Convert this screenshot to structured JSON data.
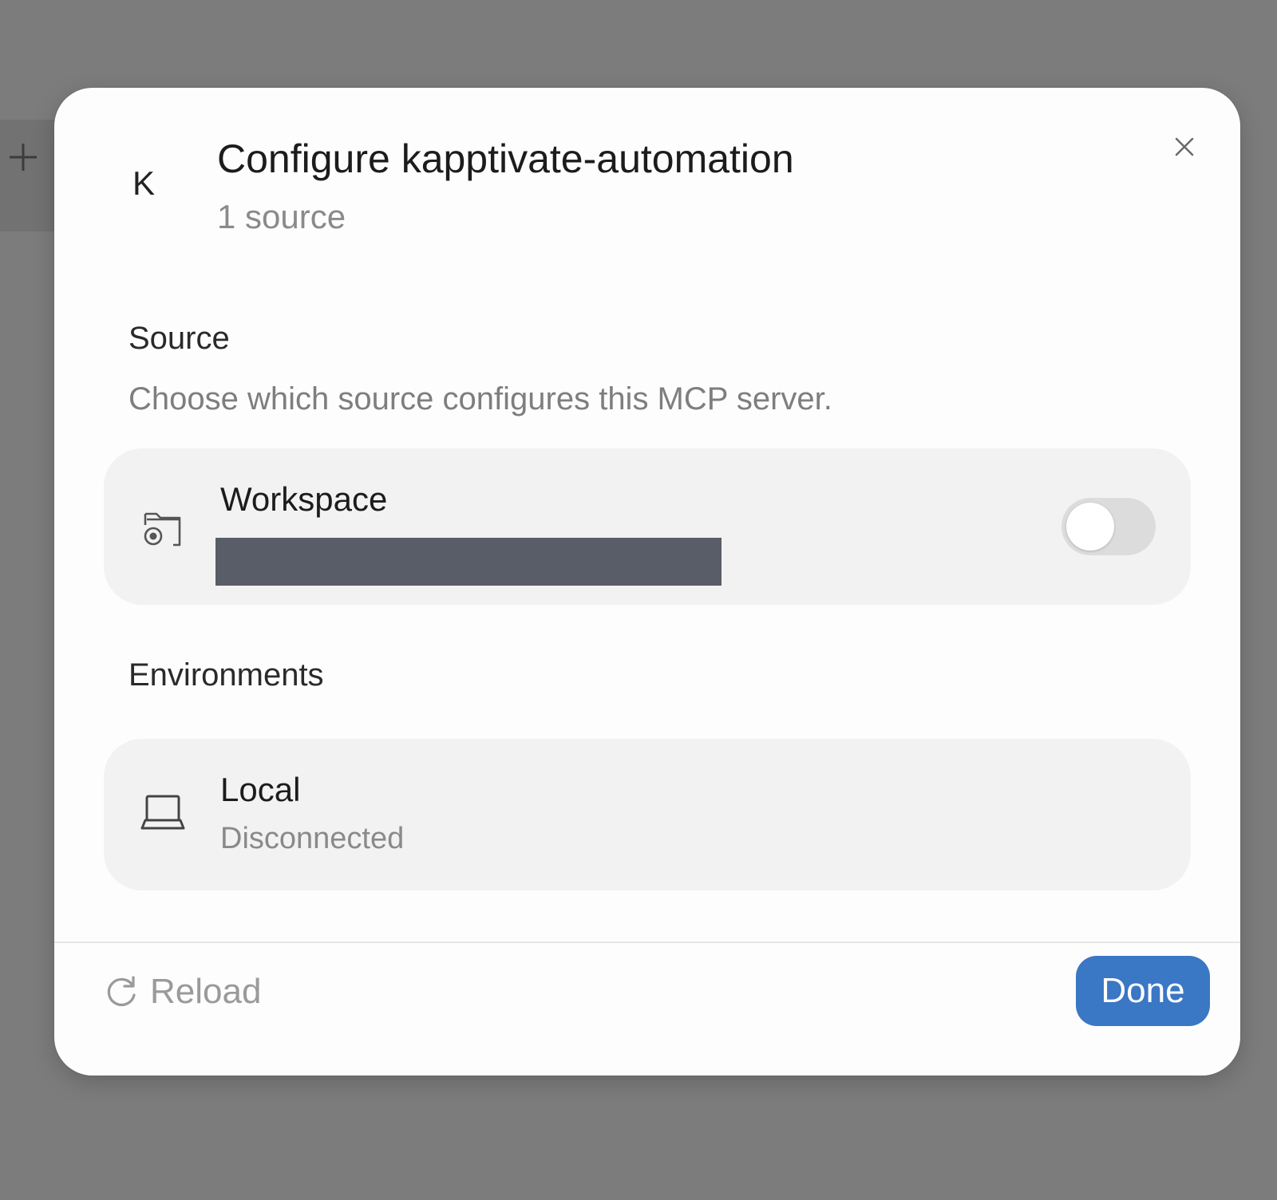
{
  "background": {
    "add_icon": "plus-icon"
  },
  "dialog": {
    "avatar_letter": "K",
    "title": "Configure kapptivate-automation",
    "subtitle": "1 source",
    "close_icon": "close-icon"
  },
  "source_section": {
    "title": "Source",
    "description": "Choose which source configures this MCP server.",
    "option": {
      "icon": "folder-settings-icon",
      "label": "Workspace",
      "enabled": false
    }
  },
  "environments_section": {
    "title": "Environments",
    "items": [
      {
        "icon": "laptop-icon",
        "label": "Local",
        "status": "Disconnected"
      }
    ]
  },
  "footer": {
    "reload_label": "Reload",
    "reload_icon": "reload-icon",
    "done_label": "Done"
  },
  "colors": {
    "accent": "#3a77c4",
    "overlay": "#7c7c7c",
    "card": "#f2f2f2"
  }
}
